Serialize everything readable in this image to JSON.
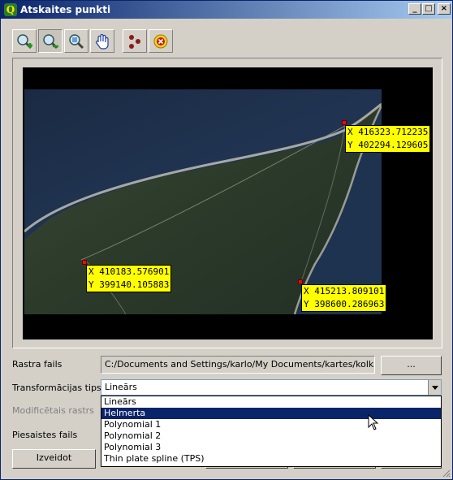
{
  "window": {
    "title": "Atskaites punkti",
    "app_icon_glyph": "Q",
    "controls": {
      "minimize": "_",
      "maximize": "□",
      "close": "×"
    }
  },
  "toolbar": {
    "tools": [
      {
        "id": "zoom-in",
        "icon": "zoom-in-icon"
      },
      {
        "id": "zoom-out",
        "icon": "zoom-out-icon",
        "active": true
      },
      {
        "id": "zoom-extent",
        "icon": "zoom-full-icon"
      },
      {
        "id": "pan",
        "icon": "pan-hand-icon"
      },
      {
        "id": "add-point",
        "icon": "add-point-icon"
      },
      {
        "id": "delete-point",
        "icon": "delete-point-icon"
      }
    ]
  },
  "gcps": [
    {
      "x": "X 416323.712235",
      "y": "Y 402294.129605"
    },
    {
      "x": "X 410183.576901",
      "y": "Y 399140.105883"
    },
    {
      "x": "X 415213.809101",
      "y": "Y 398600.286963"
    }
  ],
  "form": {
    "raster_label": "Rastra fails",
    "raster_path": "C:/Documents and Settings/karlo/My Documents/kartes/kolka.jpg",
    "browse_label": "...",
    "transform_label": "Transformācijas tips",
    "transform_value": "Lineārs",
    "modified_raster_label": "Modificētais rastrs",
    "link_file_label": "Piesaistes fails",
    "create_button": "Izveidot"
  },
  "dropdown": {
    "options": [
      "Lineārs",
      "Helmerta",
      "Polynomial 1",
      "Polynomial 2",
      "Polynomial 3",
      "Thin plate spline (TPS)"
    ],
    "highlighted_index": 1
  },
  "colors": {
    "title_start": "#0a246a",
    "title_end": "#a6caf0",
    "label_bg": "#ffff00",
    "marker": "#e01010",
    "highlight": "#0a246a"
  }
}
